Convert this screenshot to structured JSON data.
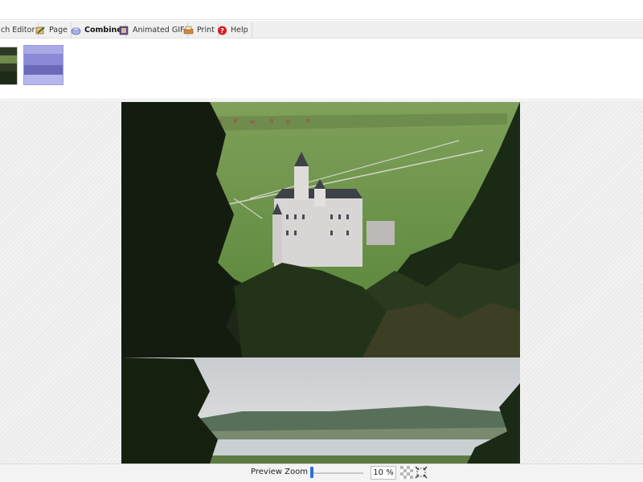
{
  "tabs": [
    {
      "label": "ch Editor",
      "icon": "editor-icon"
    },
    {
      "label": "Page",
      "icon": "page-icon"
    },
    {
      "label": "Combine",
      "icon": "combine-icon",
      "active": true
    },
    {
      "label": "Animated GIF",
      "icon": "film-icon"
    },
    {
      "label": "Print",
      "icon": "print-icon"
    },
    {
      "label": "Help",
      "icon": "help-icon"
    }
  ],
  "thumbnails": [
    {
      "name": "castle-photo",
      "selected": false
    },
    {
      "name": "lake-photo",
      "selected": true
    }
  ],
  "statusbar": {
    "zoom_label": "Preview Zoom",
    "zoom_value": "10 %",
    "zoom_level_fraction": 0.02
  },
  "colors": {
    "accent": "#2a6fd6",
    "selection": "#9a9ae8",
    "help_red": "#d62020"
  }
}
